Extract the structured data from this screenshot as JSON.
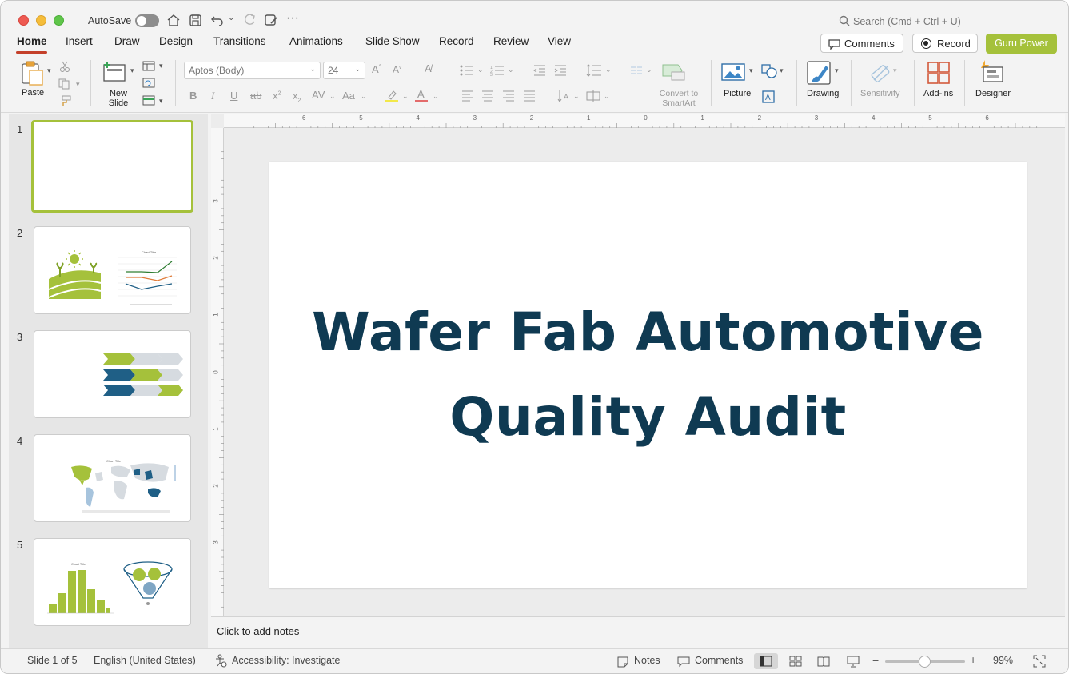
{
  "titlebar": {
    "autosave_label": "AutoSave",
    "search_placeholder": "Search (Cmd + Ctrl + U)"
  },
  "tabs": [
    {
      "label": "Home"
    },
    {
      "label": "Insert"
    },
    {
      "label": "Draw"
    },
    {
      "label": "Design"
    },
    {
      "label": "Transitions"
    },
    {
      "label": "Animations"
    },
    {
      "label": "Slide Show"
    },
    {
      "label": "Record"
    },
    {
      "label": "Review"
    },
    {
      "label": "View"
    }
  ],
  "header_actions": {
    "comments": "Comments",
    "record": "Record",
    "guru": "Guru Power"
  },
  "ribbon": {
    "paste": "Paste",
    "new_slide": "New Slide",
    "font_name": "Aptos (Body)",
    "font_size": "24",
    "convert_smartart": "Convert to SmartArt",
    "picture": "Picture",
    "drawing": "Drawing",
    "sensitivity": "Sensitivity",
    "addins": "Add-ins",
    "designer": "Designer"
  },
  "ruler": {
    "h_ticks": [
      "6",
      "5",
      "4",
      "3",
      "2",
      "1",
      "0",
      "1",
      "2",
      "3",
      "4",
      "5",
      "6"
    ],
    "v_ticks": [
      "3",
      "2",
      "1",
      "0",
      "1",
      "2",
      "3"
    ]
  },
  "thumbnails": [
    {
      "num": "1"
    },
    {
      "num": "2"
    },
    {
      "num": "3"
    },
    {
      "num": "4"
    },
    {
      "num": "5"
    }
  ],
  "slide": {
    "title_line1": "Wafer Fab Automotive",
    "title_line2": "Quality Audit"
  },
  "notes": {
    "placeholder": "Click to add notes"
  },
  "status": {
    "slide_count": "Slide 1 of 5",
    "language": "English (United States)",
    "accessibility": "Accessibility: Investigate",
    "notes": "Notes",
    "comments": "Comments",
    "zoom": "99%"
  },
  "colors": {
    "accent_green": "#a5c13b",
    "navy": "#0f3a52",
    "tab_underline": "#c4402a",
    "teal": "#1f5f86"
  }
}
